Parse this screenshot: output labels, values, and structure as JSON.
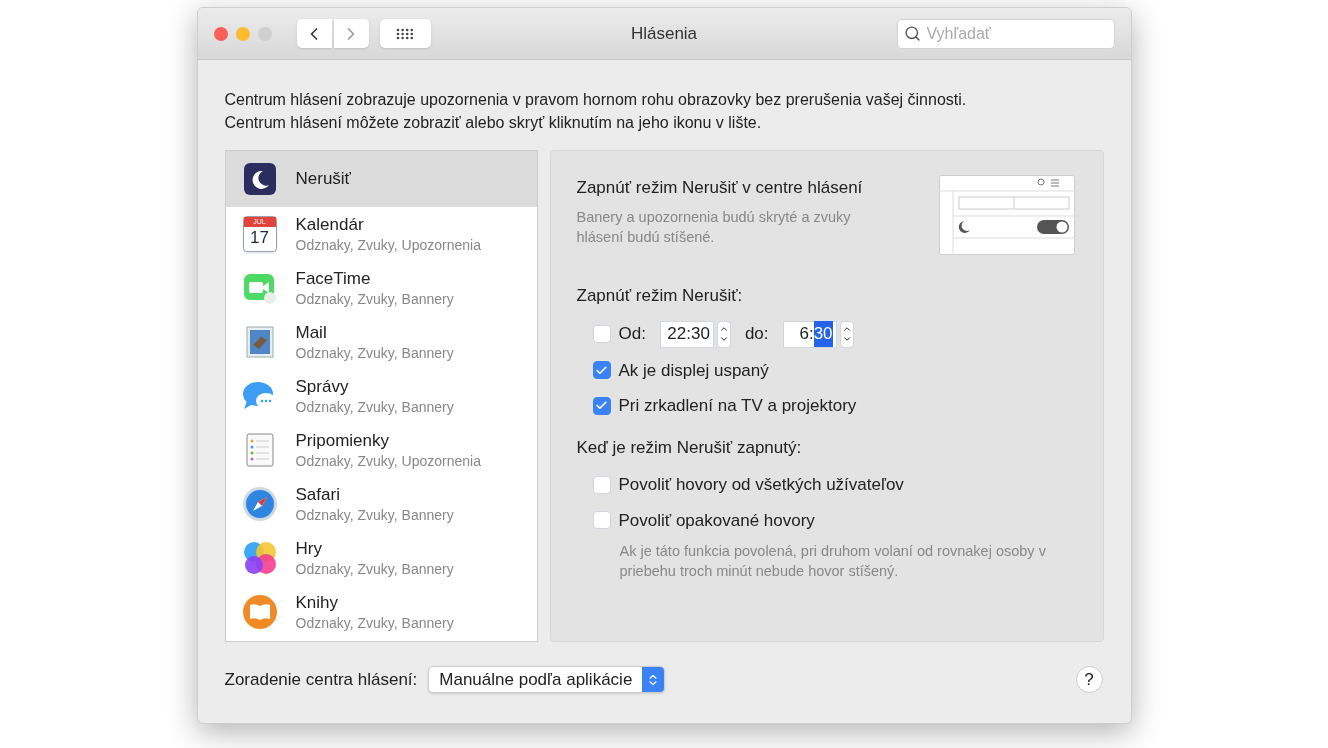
{
  "window": {
    "title": "Hlásenia",
    "search": {
      "placeholder": "Vyhľadať"
    }
  },
  "intro": [
    "Centrum hlásení zobrazuje upozornenia v pravom hornom rohu obrazovky bez prerušenia vašej činnosti.",
    "Centrum hlásení môžete zobraziť alebo skryť kliknutím na jeho ikonu v lište."
  ],
  "apps": [
    {
      "name": "Nerušiť",
      "selected": true
    },
    {
      "name": "Kalendár",
      "subtitle": "Odznaky, Zvuky, Upozornenia",
      "icon_text": [
        "JUL",
        "17"
      ],
      "selected": false
    },
    {
      "name": "FaceTime",
      "subtitle": "Odznaky, Zvuky, Bannery",
      "selected": false
    },
    {
      "name": "Mail",
      "subtitle": "Odznaky, Zvuky, Bannery",
      "selected": false
    },
    {
      "name": "Správy",
      "subtitle": "Odznaky, Zvuky, Bannery",
      "selected": false
    },
    {
      "name": "Pripomienky",
      "subtitle": "Odznaky, Zvuky, Upozornenia",
      "selected": false
    },
    {
      "name": "Safari",
      "subtitle": "Odznaky, Zvuky, Bannery",
      "selected": false
    },
    {
      "name": "Hry",
      "subtitle": "Odznaky, Zvuky, Bannery",
      "selected": false
    },
    {
      "name": "Knihy",
      "subtitle": "Odznaky, Zvuky, Bannery",
      "selected": false
    }
  ],
  "detail": {
    "heading": "Zapnúť režim Nerušiť v centre hlásení",
    "description": "Banery a upozornenia budú skryté a zvuky hlásení budú stíšené.",
    "schedule_label": "Zapnúť režim Nerušiť:",
    "schedule": {
      "checked": false,
      "from_label": "Od:",
      "from": {
        "hours": "22",
        "separator": ":",
        "minutes": "30",
        "minutes_selected": false
      },
      "to_label": "do:",
      "to": {
        "hours": "6",
        "separator": ":",
        "minutes": "30",
        "minutes_selected": true
      }
    },
    "options": [
      {
        "label": "Ak je displej uspaný",
        "checked": true
      },
      {
        "label": "Pri zrkadlení na TV a projektory",
        "checked": true
      }
    ],
    "when_on_label": "Keď je režim Nerušiť zapnutý:",
    "when_on_options": [
      {
        "label": "Povoliť hovory od všetkých užívateľov",
        "checked": false
      },
      {
        "label": "Povoliť opakované hovory",
        "checked": false
      }
    ],
    "note": "Ak je táto funkcia povolená, pri druhom volaní od rovnakej osoby v priebehu troch minút nebude hovor stíšený."
  },
  "footer": {
    "sort_label": "Zoradenie centra hlásení:",
    "sort_value": "Manuálne podľa aplikácie",
    "help": "?"
  }
}
